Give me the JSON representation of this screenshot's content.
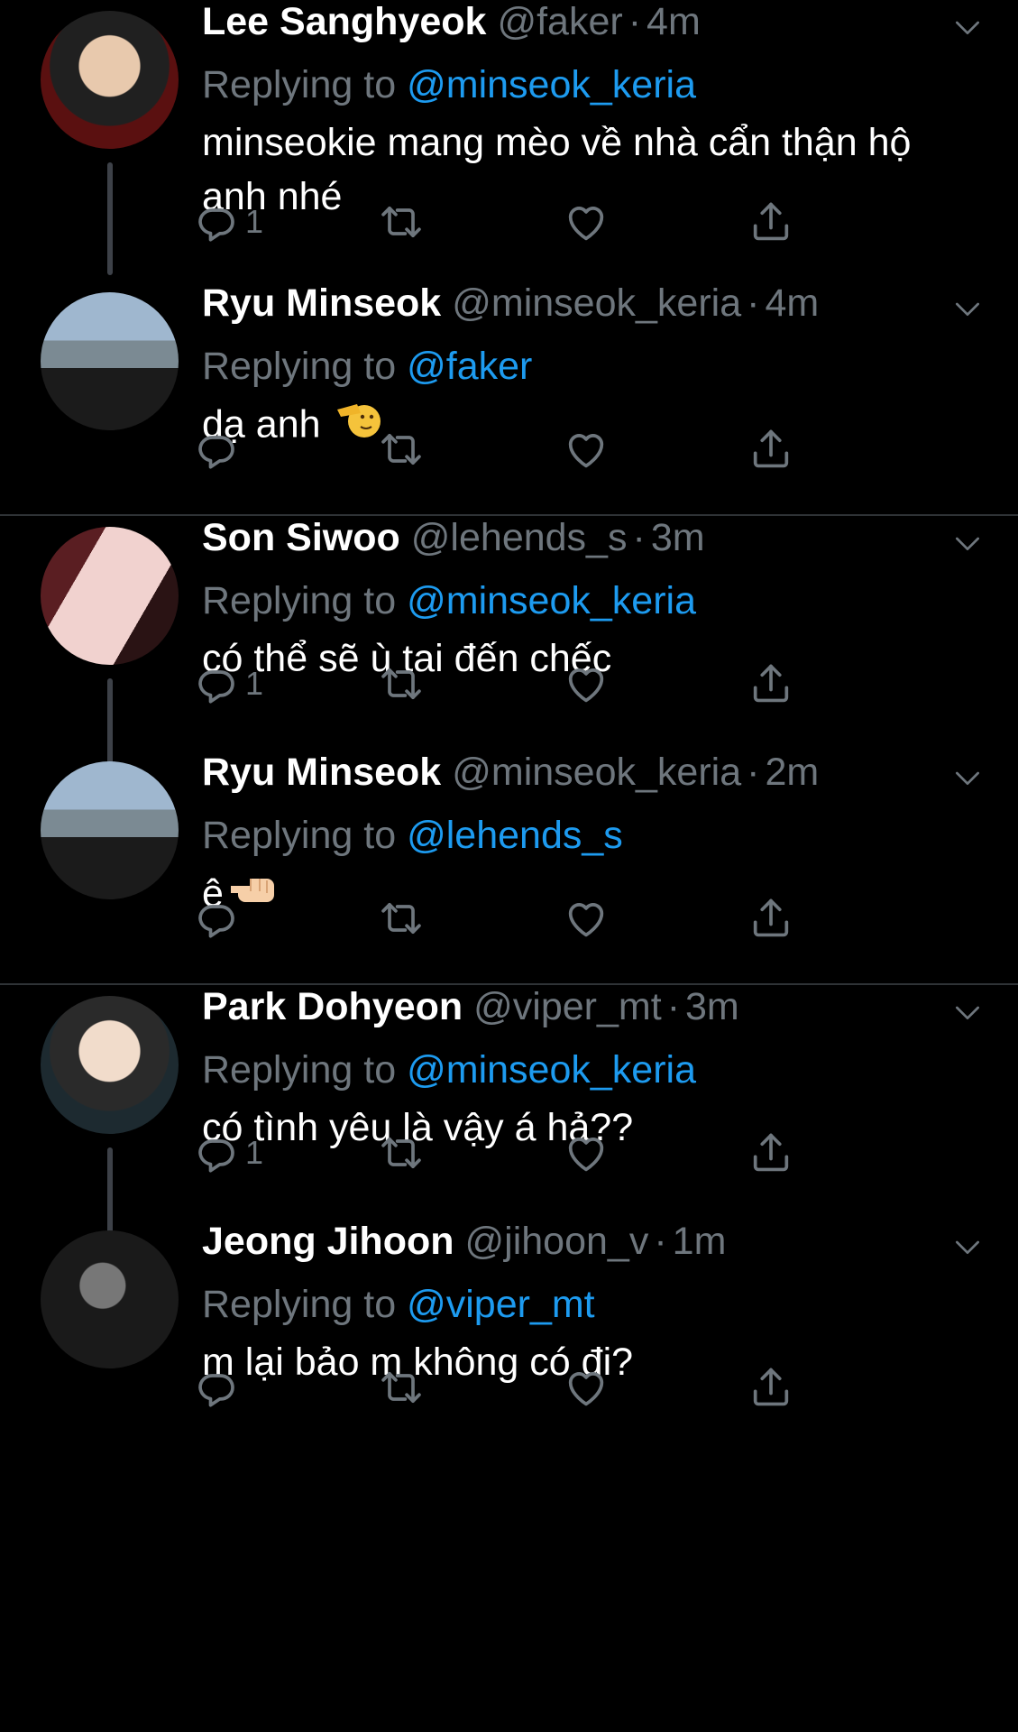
{
  "tweets": [
    {
      "name": "Lee Sanghyeok",
      "handle": "@faker",
      "time": "4m",
      "replying_prefix": "Replying to",
      "replying_to": "@minseok_keria",
      "text": "minseokie mang mèo về nhà cẩn thận hộ anh nhé",
      "emoji": "",
      "reply_count": "1"
    },
    {
      "name": "Ryu Minseok",
      "handle": "@minseok_keria",
      "time": "4m",
      "replying_prefix": "Replying to",
      "replying_to": "@faker",
      "text": "dạ anh",
      "emoji": "salute-emoji",
      "reply_count": ""
    },
    {
      "name": "Son Siwoo",
      "handle": "@lehends_s",
      "time": "3m",
      "replying_prefix": "Replying to",
      "replying_to": "@minseok_keria",
      "text": "có thể sẽ ù tai đến chếc",
      "emoji": "",
      "reply_count": "1"
    },
    {
      "name": "Ryu Minseok",
      "handle": "@minseok_keria",
      "time": "2m",
      "replying_prefix": "Replying to",
      "replying_to": "@lehends_s",
      "text": "ê",
      "emoji": "pointing-fist-emoji",
      "reply_count": ""
    },
    {
      "name": "Park Dohyeon",
      "handle": "@viper_mt",
      "time": "3m",
      "replying_prefix": "Replying to",
      "replying_to": "@minseok_keria",
      "text": "có tình yêu là vậy á hả??",
      "emoji": "",
      "reply_count": "1"
    },
    {
      "name": "Jeong Jihoon",
      "handle": "@jihoon_v",
      "time": "1m",
      "replying_prefix": "Replying to",
      "replying_to": "@viper_mt",
      "text": "m lại bảo m không có đi?",
      "emoji": "",
      "reply_count": ""
    }
  ],
  "separator": "·",
  "colors": {
    "background": "#000000",
    "text": "#ffffff",
    "muted": "#6e767d",
    "link": "#1d9bf0",
    "thread_line": "#3d4148",
    "divider": "#2f3336"
  }
}
